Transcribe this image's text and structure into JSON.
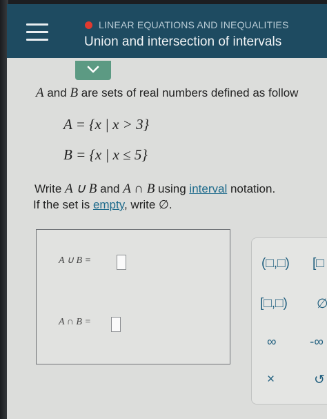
{
  "header": {
    "topic": "LINEAR EQUATIONS AND INEQUALITIES",
    "title": "Union and intersection of intervals",
    "colors": {
      "bar": "#1e4b61",
      "dot": "#e03a2f",
      "tab": "#5c9a83",
      "link": "#1f6b8c"
    }
  },
  "problem": {
    "intro_text": "are sets of real numbers defined as follow",
    "intro_a": "A",
    "intro_and": "and",
    "intro_b": "B",
    "set_a": "A = {x | x > 3}",
    "set_b": "B = {x | x ≤ 5}",
    "instruction_write": "Write",
    "instruction_union": "A ∪ B",
    "instruction_and": "and",
    "instruction_intersection": "A ∩ B",
    "instruction_using": "using",
    "interval_link": "interval",
    "instruction_notation": "notation.",
    "empty_prefix": "If the set is",
    "empty_link": "empty",
    "empty_suffix": ", write ∅."
  },
  "answers": {
    "union_label": "A ∪ B =",
    "intersection_label": "A ∩ B =",
    "union_value": "",
    "intersection_value": ""
  },
  "keypad": {
    "open_interval": "(□,□)",
    "half_open_left": "[□",
    "closed_open": "[□,□)",
    "empty_set": "∅",
    "infinity": "∞",
    "neg_infinity": "-∞",
    "clear": "×",
    "undo": "↺"
  }
}
